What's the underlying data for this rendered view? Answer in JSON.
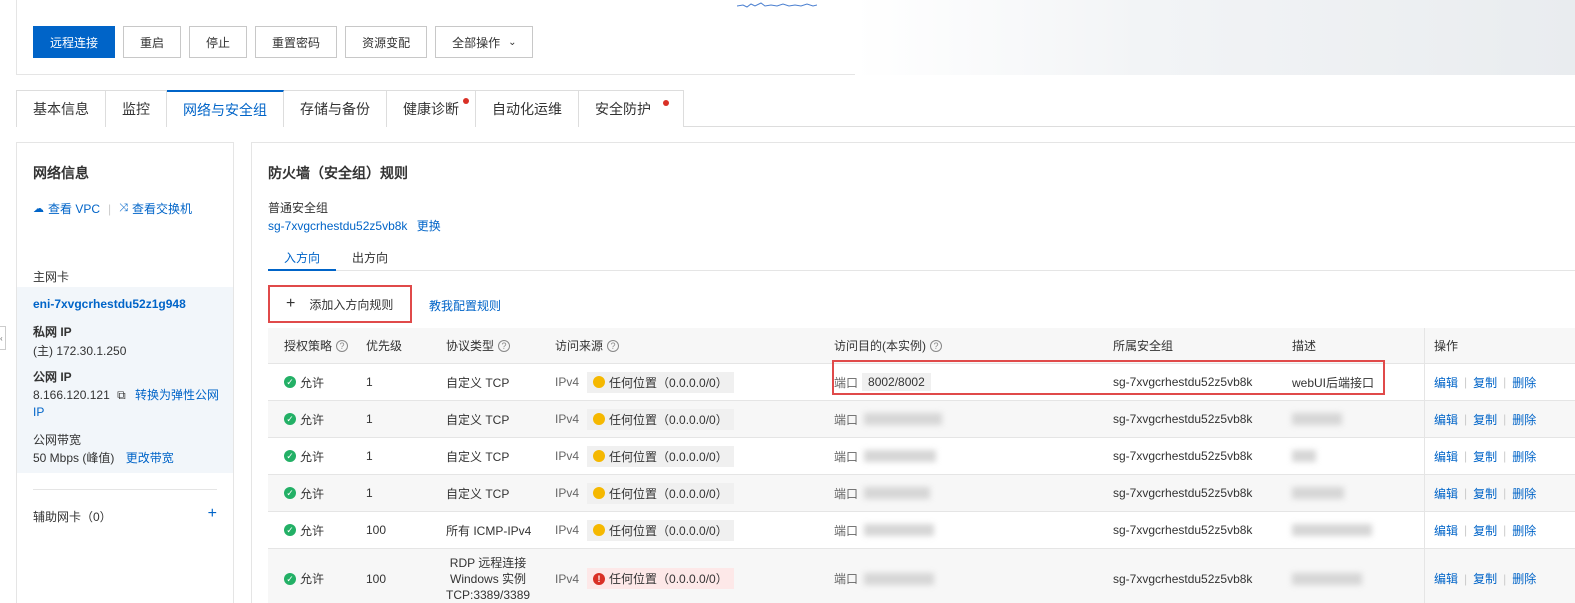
{
  "toolbar": {
    "remote_connect": "远程连接",
    "restart": "重启",
    "stop": "停止",
    "reset_password": "重置密码",
    "change_config": "资源变配",
    "all_actions": "全部操作"
  },
  "tabs": [
    {
      "label": "基本信息"
    },
    {
      "label": "监控"
    },
    {
      "label": "网络与安全组"
    },
    {
      "label": "存储与备份"
    },
    {
      "label": "健康诊断"
    },
    {
      "label": "自动化运维"
    },
    {
      "label": "安全防护"
    }
  ],
  "network": {
    "title": "网络信息",
    "view_vpc": "查看 VPC",
    "view_vswitch": "查看交换机",
    "primary_nic_label": "主网卡",
    "nic_id": "eni-7xvgcrhestdu52z1g948",
    "private_ip_label": "私网 IP",
    "private_ip": "(主) 172.30.1.250",
    "public_ip_label": "公网 IP",
    "public_ip": "8.166.120.121",
    "convert_eip": "转换为弹性公网",
    "convert_eip_cont": "IP",
    "bandwidth_label": "公网带宽",
    "bandwidth": "50 Mbps (峰值)",
    "change_bandwidth": "更改带宽",
    "secondary_nic": "辅助网卡（0）"
  },
  "firewall": {
    "title": "防火墙（安全组）规则",
    "sg_type": "普通安全组",
    "sg_id": "sg-7xvgcrhestdu52z5vb8k",
    "change": "更换",
    "inbound": "入方向",
    "outbound": "出方向",
    "add_rule": "添加入方向规则",
    "teach": "教我配置规则"
  },
  "table": {
    "headers": {
      "policy": "授权策略",
      "priority": "优先级",
      "protocol": "协议类型",
      "source": "访问来源",
      "dest": "访问目的(本实例)",
      "group": "所属安全组",
      "desc": "描述",
      "ops": "操作"
    },
    "port_label": "端口",
    "ipv4": "IPv4",
    "edit": "编辑",
    "copy": "复制",
    "delete": "删除",
    "rows": [
      {
        "policy": "允许",
        "priority": "1",
        "protocol": "自定义 TCP",
        "source": "任何位置（0.0.0.0/0）",
        "port": "8002/8002",
        "group": "sg-7xvgcrhestdu52z5vb8k",
        "desc": "webUI后端接口"
      },
      {
        "policy": "允许",
        "priority": "1",
        "protocol": "自定义 TCP",
        "source": "任何位置（0.0.0.0/0）",
        "port": "",
        "group": "sg-7xvgcrhestdu52z5vb8k",
        "desc": ""
      },
      {
        "policy": "允许",
        "priority": "1",
        "protocol": "自定义 TCP",
        "source": "任何位置（0.0.0.0/0）",
        "port": "",
        "group": "sg-7xvgcrhestdu52z5vb8k",
        "desc": ""
      },
      {
        "policy": "允许",
        "priority": "1",
        "protocol": "自定义 TCP",
        "source": "任何位置（0.0.0.0/0）",
        "port": "",
        "group": "sg-7xvgcrhestdu52z5vb8k",
        "desc": ""
      },
      {
        "policy": "允许",
        "priority": "100",
        "protocol": "所有 ICMP-IPv4",
        "source": "任何位置（0.0.0.0/0）",
        "port": "",
        "group": "sg-7xvgcrhestdu52z5vb8k",
        "desc": ""
      },
      {
        "policy": "允许",
        "priority": "100",
        "protocol_lines": [
          "RDP 远程连接",
          "Windows 实例",
          "TCP:3389/3389"
        ],
        "source": "任何位置（0.0.0.0/0）",
        "port": "",
        "group": "sg-7xvgcrhestdu52z5vb8k",
        "desc": ""
      }
    ]
  },
  "colors": {
    "primary": "#0064c8",
    "alert_dot": "#d93026",
    "highlight_box": "#e04a4a",
    "allow_icon": "#23b066",
    "warn_icon": "#f5b800"
  }
}
